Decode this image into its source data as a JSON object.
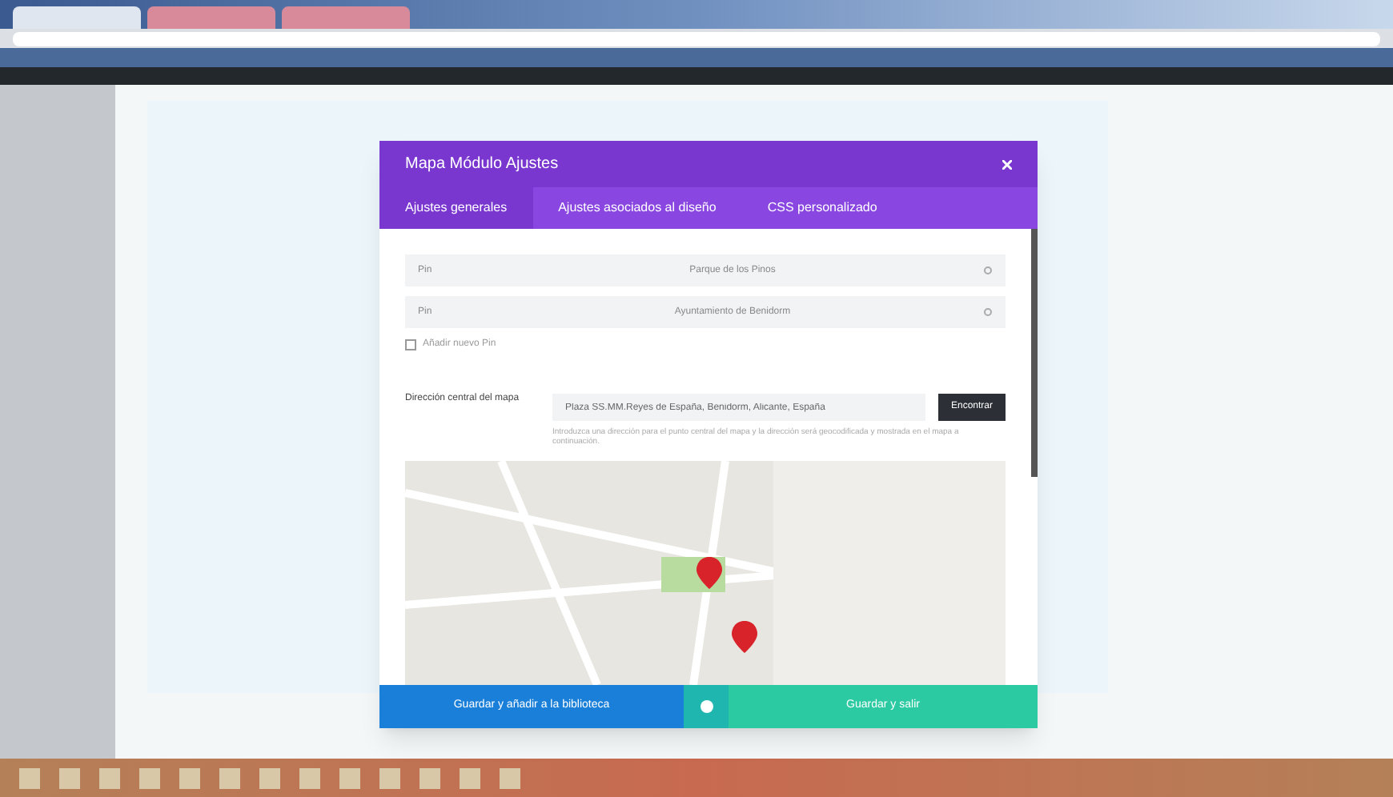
{
  "browser": {
    "tabs": [
      {
        "selected": true
      },
      {
        "selected": false
      },
      {
        "selected": false
      }
    ]
  },
  "modal": {
    "title": "Mapa Módulo Ajustes",
    "tabs": [
      {
        "label": "Ajustes generales",
        "selected": true
      },
      {
        "label": "Ajustes asociados al diseño",
        "selected": false
      },
      {
        "label": "CSS personalizado",
        "selected": false
      }
    ],
    "pins": [
      {
        "prefix": "Pin",
        "title": "Parque de los Pinos"
      },
      {
        "prefix": "Pin",
        "title": "Ayuntamiento de Benidorm"
      }
    ],
    "add_pin": {
      "label": "Añadir nuevo Pin",
      "checked": false
    },
    "address": {
      "label": "Dirección central del mapa",
      "value": "Plaza SS.MM.Reyes de España, Benidorm, Alicante, España",
      "button": "Encontrar",
      "help": "Introduzca una dirección para el punto central del mapa y la dirección será geocodificada y mostrada en el mapa a continuación."
    },
    "footer": {
      "save_library": "Guardar y añadir a la biblioteca",
      "save_exit": "Guardar y salir"
    }
  }
}
